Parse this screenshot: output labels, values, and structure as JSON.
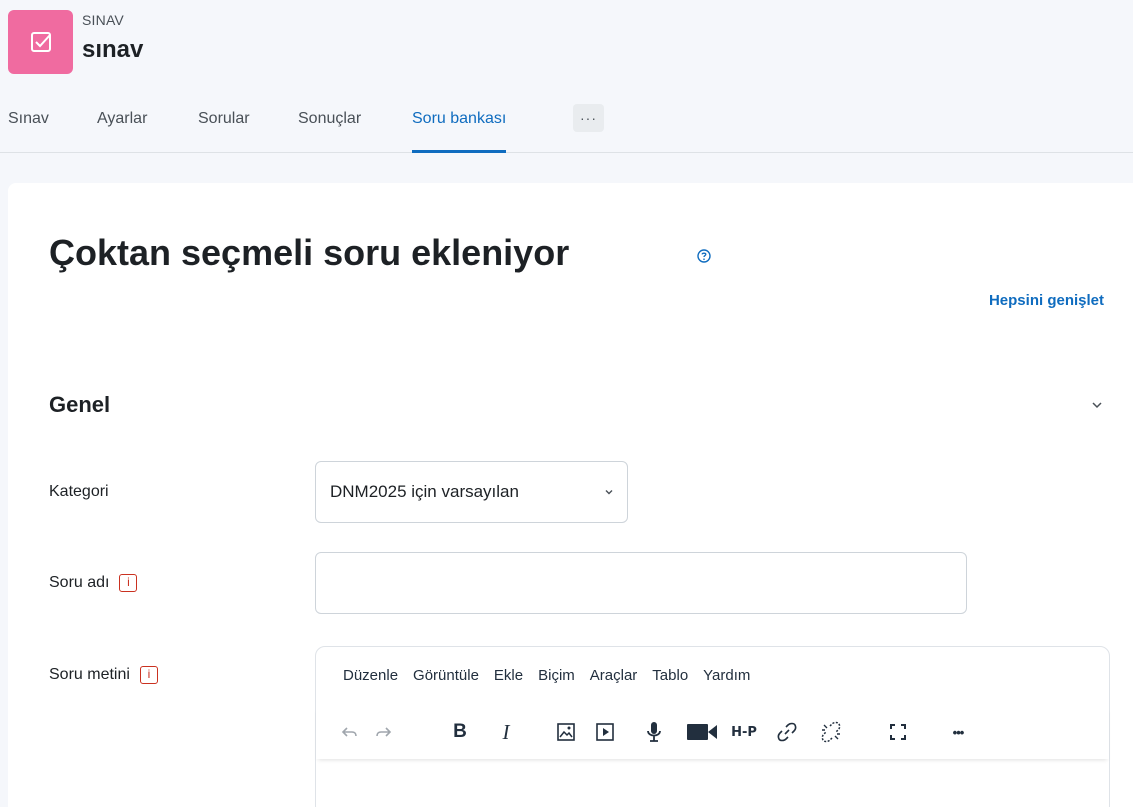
{
  "activity": {
    "type_label": "SINAV",
    "name": "sınav",
    "icon": "checkbox-icon",
    "icon_color": "#f06ba0"
  },
  "nav": {
    "tabs": [
      {
        "label": "Sınav",
        "active": false
      },
      {
        "label": "Ayarlar",
        "active": false
      },
      {
        "label": "Sorular",
        "active": false
      },
      {
        "label": "Sonuçlar",
        "active": false
      },
      {
        "label": "Soru bankası",
        "active": true
      }
    ],
    "more_label": "···"
  },
  "page": {
    "title": "Çoktan seçmeli soru ekleniyor",
    "expand_all": "Hepsini genişlet"
  },
  "section": {
    "title": "Genel"
  },
  "form": {
    "category_label": "Kategori",
    "category_value": "DNM2025 için varsayılan",
    "name_label": "Soru adı",
    "name_value": "",
    "text_label": "Soru metini",
    "required_icon": "i"
  },
  "editor": {
    "menu": [
      "Düzenle",
      "Görüntüle",
      "Ekle",
      "Biçim",
      "Araçlar",
      "Tablo",
      "Yardım"
    ],
    "toolbar": [
      "undo-icon",
      "redo-icon",
      "bold-icon",
      "italic-icon",
      "image-icon",
      "media-icon",
      "record-audio-icon",
      "record-video-icon",
      "h5p-icon",
      "link-icon",
      "unlink-icon",
      "fullscreen-icon",
      "more-icon"
    ],
    "bold_glyph": "B",
    "italic_glyph": "I",
    "h5p_glyph": "H-P",
    "more_glyph": "•••"
  },
  "colors": {
    "accent": "#0f6cbf",
    "required": "#ca3120"
  }
}
